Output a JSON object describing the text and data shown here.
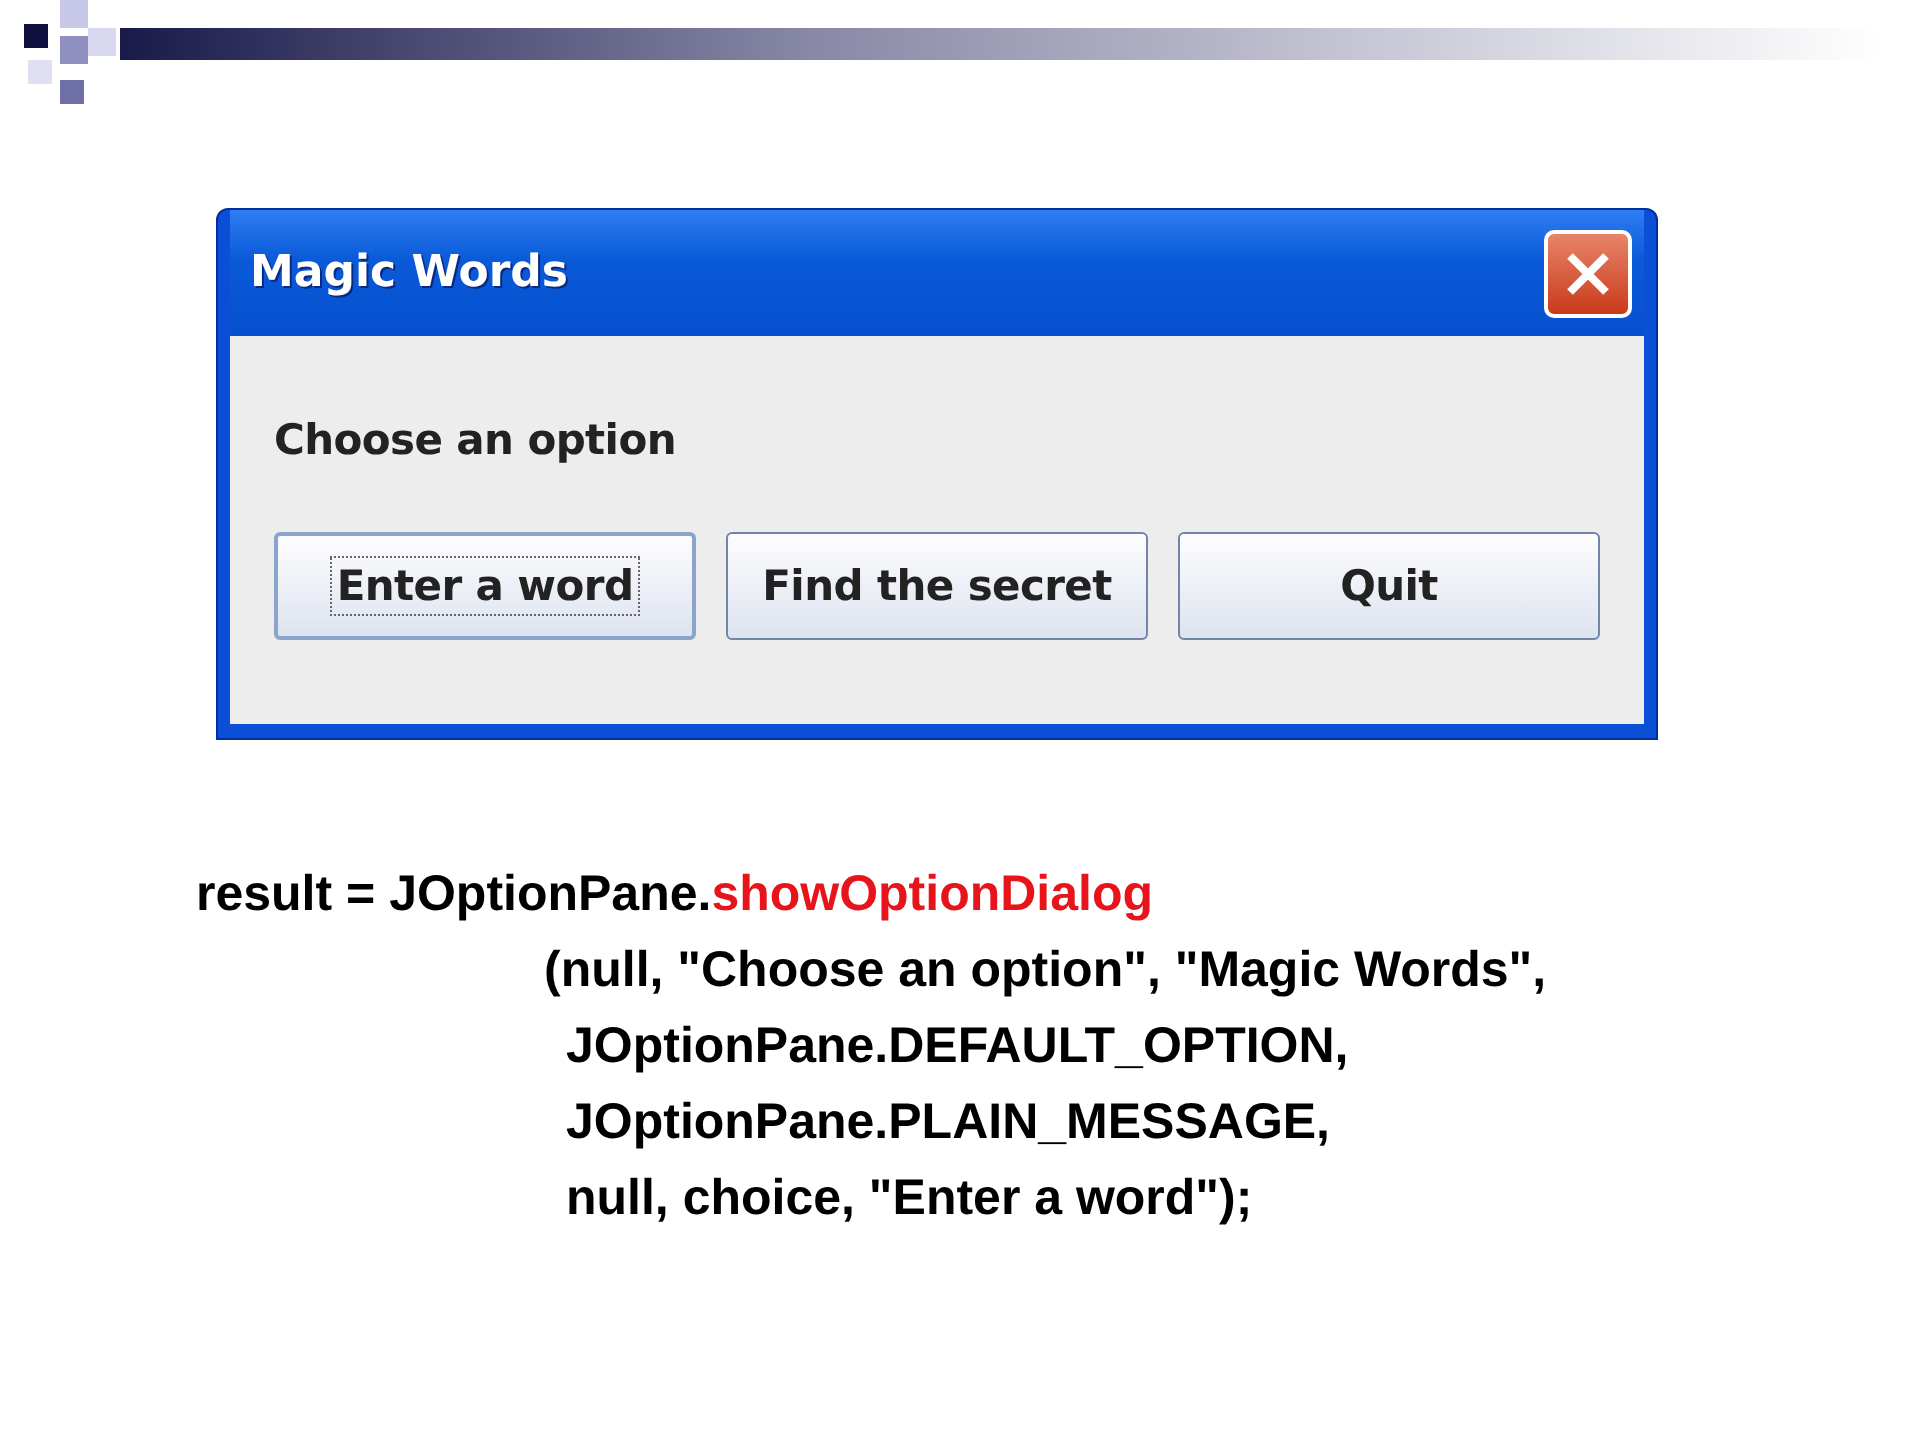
{
  "dialog": {
    "title": "Magic Words",
    "message": "Choose an option",
    "buttons": [
      {
        "label": "Enter a word",
        "focused": true
      },
      {
        "label": "Find the secret",
        "focused": false
      },
      {
        "label": "Quit",
        "focused": false
      }
    ]
  },
  "code": {
    "lines": [
      {
        "kind": "statement",
        "parts": [
          {
            "text": "result = JOptionPane.",
            "kind": "plain"
          },
          {
            "text": "showOptionDialog",
            "kind": "method"
          }
        ]
      },
      {
        "kind": "call",
        "parts": [
          {
            "text": "(null, \"Choose an option\", \"Magic Words\",",
            "kind": "plain"
          }
        ]
      },
      {
        "kind": "argument",
        "parts": [
          {
            "text": "JOptionPane.DEFAULT_OPTION,",
            "kind": "plain"
          }
        ]
      },
      {
        "kind": "argument",
        "parts": [
          {
            "text": "JOptionPane.PLAIN_MESSAGE,",
            "kind": "plain"
          }
        ]
      },
      {
        "kind": "argument",
        "parts": [
          {
            "text": "null, choice, \"Enter a word\");",
            "kind": "plain"
          }
        ]
      }
    ]
  }
}
